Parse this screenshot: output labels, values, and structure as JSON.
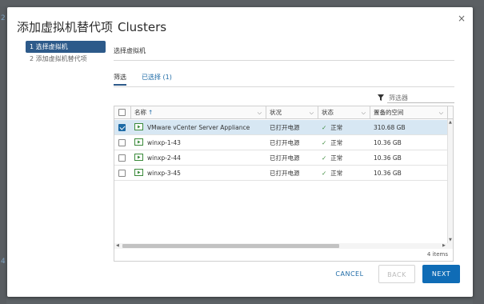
{
  "background": {
    "left_fragments": [
      "2",
      "4"
    ]
  },
  "dialog": {
    "title": "添加虚拟机替代项",
    "title_sub": "Clusters",
    "close_glyph": "×"
  },
  "steps": [
    {
      "label": "1 选择虚拟机",
      "active": true
    },
    {
      "label": "2 添加虚拟机替代项",
      "active": false
    }
  ],
  "content": {
    "section_title": "选择虚拟机",
    "tabs": [
      {
        "label": "筛选",
        "selected": true
      },
      {
        "label": "已选择 (1)",
        "selected": false
      }
    ],
    "filter": {
      "placeholder": "筛选器",
      "icon": "funnel-icon"
    }
  },
  "table": {
    "columns": [
      {
        "label": "名称",
        "sort": "↑"
      },
      {
        "label": "状况"
      },
      {
        "label": "状态"
      },
      {
        "label": "置备的空间"
      }
    ],
    "rows": [
      {
        "name": "VMware vCenter Server Appliance",
        "state": "已打开电源",
        "status": "正常",
        "space": "310.68 GB",
        "checked": true
      },
      {
        "name": "winxp-1-43",
        "state": "已打开电源",
        "status": "正常",
        "space": "10.36 GB",
        "checked": false
      },
      {
        "name": "winxp-2-44",
        "state": "已打开电源",
        "status": "正常",
        "space": "10.36 GB",
        "checked": false
      },
      {
        "name": "winxp-3-45",
        "state": "已打开电源",
        "status": "正常",
        "space": "10.36 GB",
        "checked": false
      }
    ],
    "item_count": "4 items"
  },
  "buttons": {
    "cancel": "CANCEL",
    "back": "BACK",
    "next": "NEXT"
  },
  "colors": {
    "accent": "#0f6cb6",
    "step_active": "#2d5a8a",
    "row_selected": "#d7e7f3",
    "ok_green": "#3a8a3a"
  }
}
